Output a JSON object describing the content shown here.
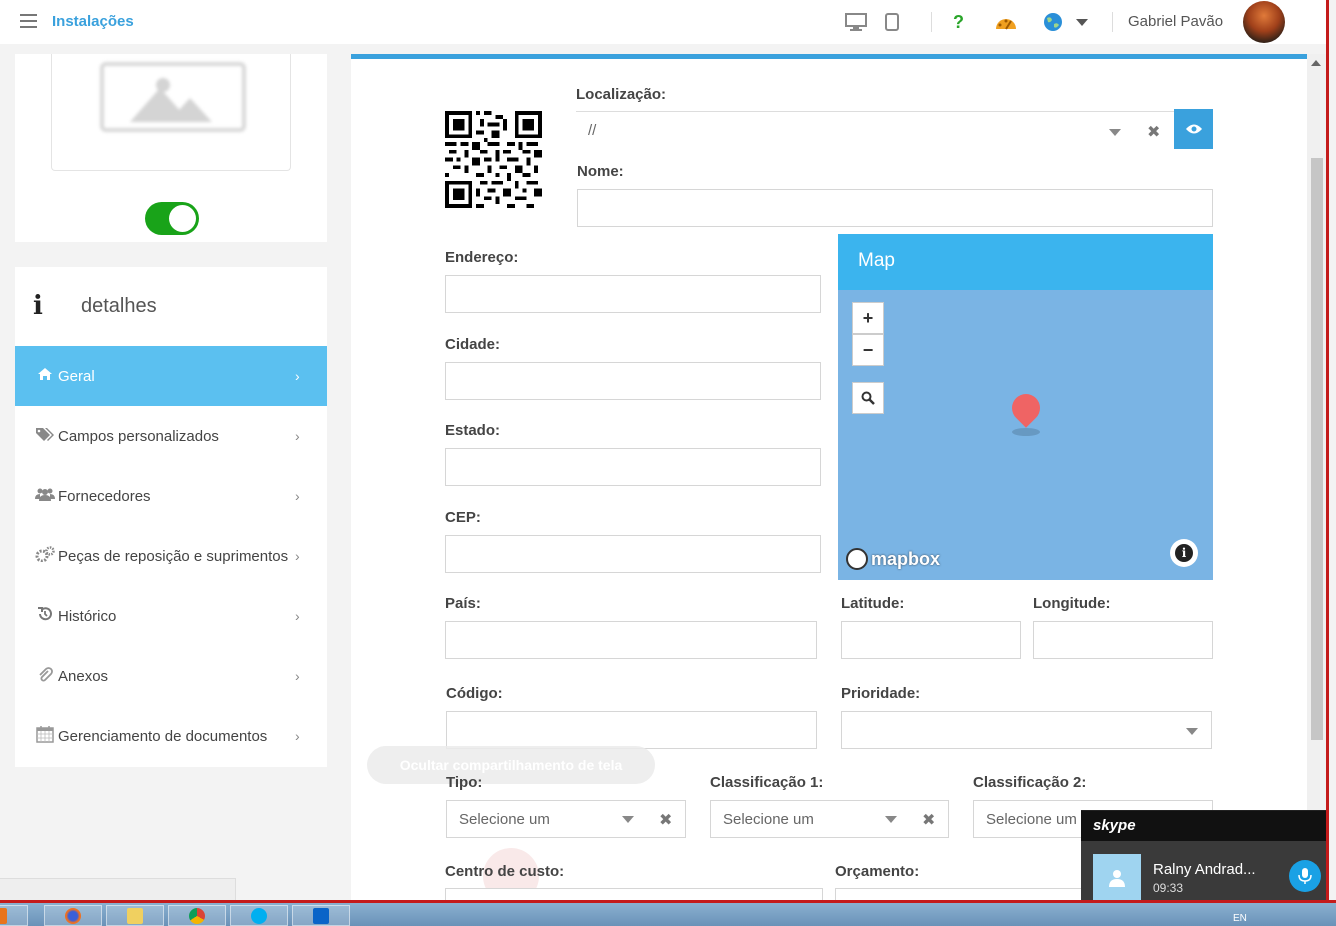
{
  "header": {
    "title": "Instalações",
    "user_name": "Gabriel Pavão"
  },
  "sidebar": {
    "section_title": "detalhes",
    "items": [
      {
        "label": "Geral",
        "icon": "home-icon"
      },
      {
        "label": "Campos personalizados",
        "icon": "tags-icon"
      },
      {
        "label": "Fornecedores",
        "icon": "users-icon"
      },
      {
        "label": "Peças de reposição e suprimentos",
        "icon": "gears-icon"
      },
      {
        "label": "Histórico",
        "icon": "history-icon"
      },
      {
        "label": "Anexos",
        "icon": "paperclip-icon"
      },
      {
        "label": "Gerenciamento de documentos",
        "icon": "calendar-icon"
      }
    ]
  },
  "form": {
    "localizacao_label": "Localização:",
    "localizacao_value": "//",
    "nome_label": "Nome:",
    "endereco_label": "Endereço:",
    "cidade_label": "Cidade:",
    "estado_label": "Estado:",
    "cep_label": "CEP:",
    "pais_label": "País:",
    "latitude_label": "Latitude:",
    "longitude_label": "Longitude:",
    "codigo_label": "Código:",
    "prioridade_label": "Prioridade:",
    "tipo_label": "Tipo:",
    "tipo_placeholder": "Selecione um",
    "class1_label": "Classificação 1:",
    "class1_placeholder": "Selecione um",
    "class2_label": "Classificação 2:",
    "class2_placeholder": "Selecione um",
    "centro_label": "Centro de custo:",
    "orcamento_label": "Orçamento:"
  },
  "map": {
    "title": "Map",
    "zoom_in": "+",
    "zoom_out": "−",
    "logo": "mapbox"
  },
  "overlay": {
    "screen_share": "Ocultar compartilhamento de tela"
  },
  "skype": {
    "brand": "skype",
    "caller": "Ralny Andrad...",
    "time": "09:33"
  },
  "taskbar": {
    "tray_lang": "EN"
  }
}
